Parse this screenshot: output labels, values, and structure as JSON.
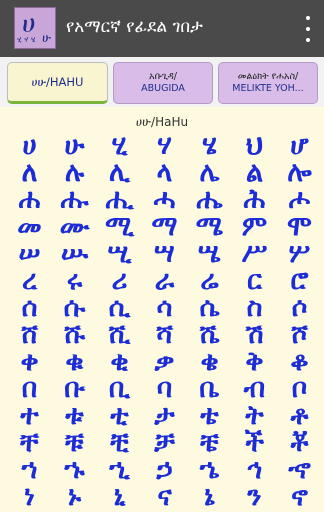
{
  "app": {
    "title": "የአማርኛ የፊደል ገበታ",
    "icon": {
      "glyph": "ሀ",
      "sub": "ሁ",
      "side": "ሂ ሃ ሄ"
    },
    "menu_icon": "overflow-menu-icon"
  },
  "tabs": [
    {
      "label": "ሀሁ/HAHU",
      "line2": ""
    },
    {
      "label": "አቡጊዳ/",
      "line2": "ABUGIDA"
    },
    {
      "label": "መልዕክት የሐአስ/",
      "line2": "MELIKTE YOH..."
    }
  ],
  "content": {
    "title": "ሀሁ/HaHu",
    "rows": [
      [
        "ሀ",
        "ሁ",
        "ሂ",
        "ሃ",
        "ሄ",
        "ህ",
        "ሆ"
      ],
      [
        "ለ",
        "ሉ",
        "ሊ",
        "ላ",
        "ሌ",
        "ል",
        "ሎ"
      ],
      [
        "ሐ",
        "ሑ",
        "ሒ",
        "ሓ",
        "ሔ",
        "ሕ",
        "ሖ"
      ],
      [
        "መ",
        "ሙ",
        "ሚ",
        "ማ",
        "ሜ",
        "ም",
        "ሞ"
      ],
      [
        "ሠ",
        "ሡ",
        "ሢ",
        "ሣ",
        "ሤ",
        "ሥ",
        "ሦ"
      ],
      [
        "ረ",
        "ሩ",
        "ሪ",
        "ራ",
        "ሬ",
        "ር",
        "ሮ"
      ],
      [
        "ሰ",
        "ሱ",
        "ሲ",
        "ሳ",
        "ሴ",
        "ስ",
        "ሶ"
      ],
      [
        "ሸ",
        "ሹ",
        "ሺ",
        "ሻ",
        "ሼ",
        "ሽ",
        "ሾ"
      ],
      [
        "ቀ",
        "ቁ",
        "ቂ",
        "ቃ",
        "ቄ",
        "ቅ",
        "ቆ"
      ],
      [
        "በ",
        "ቡ",
        "ቢ",
        "ባ",
        "ቤ",
        "ብ",
        "ቦ"
      ],
      [
        "ተ",
        "ቱ",
        "ቲ",
        "ታ",
        "ቴ",
        "ት",
        "ቶ"
      ],
      [
        "ቸ",
        "ቹ",
        "ቺ",
        "ቻ",
        "ቼ",
        "ች",
        "ቾ"
      ],
      [
        "ኀ",
        "ኁ",
        "ኂ",
        "ኃ",
        "ኄ",
        "ኅ",
        "ኆ"
      ],
      [
        "ነ",
        "ኑ",
        "ኒ",
        "ና",
        "ኔ",
        "ን",
        "ኖ"
      ]
    ]
  }
}
